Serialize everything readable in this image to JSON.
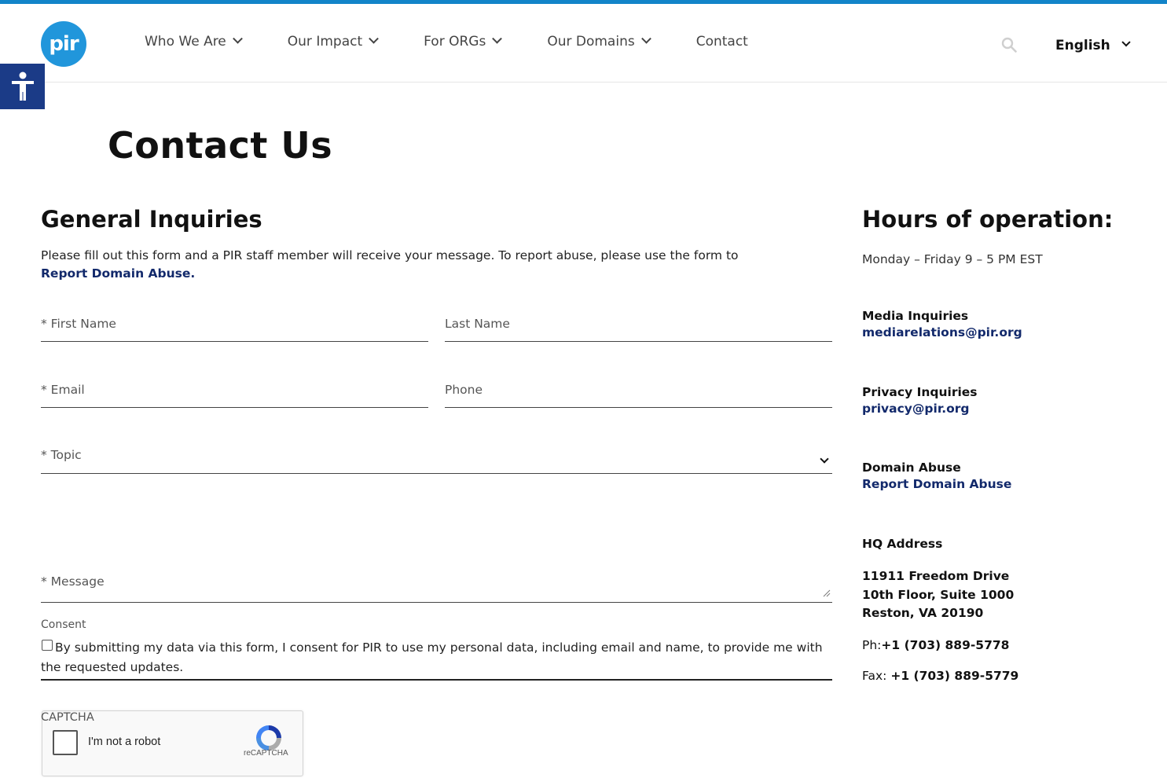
{
  "header": {
    "logo_text": "pir",
    "nav": [
      {
        "label": "Who We Are",
        "has_dropdown": true
      },
      {
        "label": "Our Impact",
        "has_dropdown": true
      },
      {
        "label": "For ORGs",
        "has_dropdown": true
      },
      {
        "label": "Our Domains",
        "has_dropdown": true
      },
      {
        "label": "Contact",
        "has_dropdown": false
      }
    ],
    "search_icon": "search-icon",
    "language": "English"
  },
  "accessibility_button_icon": "accessibility-person-icon",
  "page_title": "Contact Us",
  "form": {
    "title": "General Inquiries",
    "intro_text": "Please fill out this form and a PIR staff member will receive your message.  To report abuse, please use the form to ",
    "intro_link": "Report Domain Abuse.",
    "first_name_placeholder": "* First Name",
    "last_name_placeholder": "Last Name",
    "email_placeholder": "* Email",
    "phone_placeholder": "Phone",
    "topic_placeholder": "* Topic",
    "message_placeholder": "* Message",
    "consent_label": "Consent",
    "consent_text": "By submitting my data via this form, I consent for PIR to use my personal data, including email and name, to provide me with the requested updates.",
    "captcha_label": "CAPTCHA",
    "captcha_text": "I'm not a robot",
    "captcha_brand": "reCAPTCHA"
  },
  "sidebar": {
    "title": "Hours of operation:",
    "hours": "Monday – Friday 9 – 5 PM EST",
    "media_heading": "Media Inquiries",
    "media_email": "mediarelations@pir.org",
    "privacy_heading": "Privacy Inquiries",
    "privacy_email": "privacy@pir.org",
    "abuse_heading": "Domain Abuse",
    "abuse_link": "Report Domain Abuse",
    "hq_heading": "HQ Address",
    "address_line1": "11911 Freedom Drive",
    "address_line2": "10th Floor, Suite 1000",
    "address_line3": "Reston, VA 20190",
    "phone_label": "Ph:",
    "phone": "+1 (703) 889-5778",
    "fax_label": "Fax: ",
    "fax": "+1 (703) 889-5779"
  },
  "colors": {
    "accent_bar": "#1284c9",
    "logo": "#2196db",
    "link": "#12296b",
    "accessibility": "#1b3b87"
  }
}
